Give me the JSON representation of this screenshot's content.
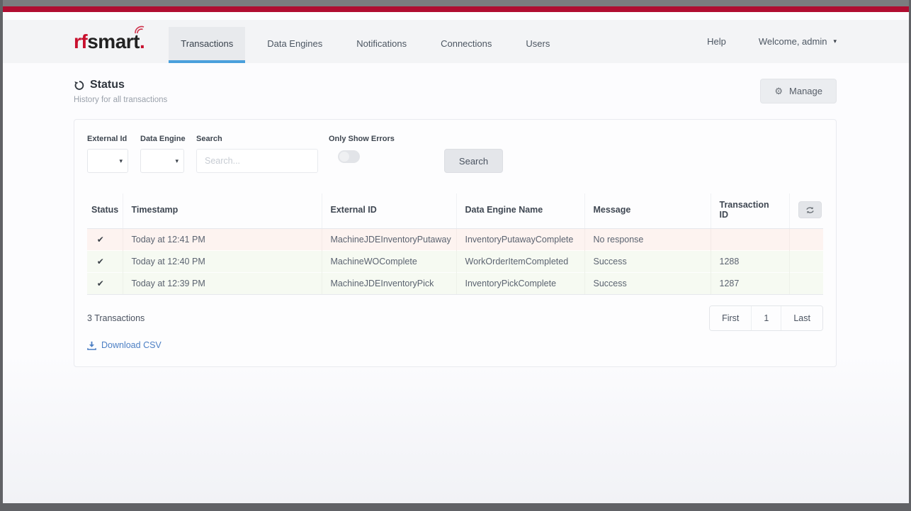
{
  "brand": {
    "logo_rf": "rf",
    "logo_smart": "smart",
    "logo_dot": "."
  },
  "nav": {
    "tabs": [
      {
        "label": "Transactions",
        "active": true
      },
      {
        "label": "Data Engines",
        "active": false
      },
      {
        "label": "Notifications",
        "active": false
      },
      {
        "label": "Connections",
        "active": false
      },
      {
        "label": "Users",
        "active": false
      }
    ],
    "help": "Help",
    "user_menu": "Welcome, admin"
  },
  "header": {
    "title": "Status",
    "subtitle": "History for all transactions",
    "manage_label": "Manage"
  },
  "filters": {
    "external_id_label": "External Id",
    "data_engine_label": "Data Engine",
    "search_label": "Search",
    "only_show_errors_label": "Only Show Errors",
    "search_placeholder": "Search...",
    "search_button": "Search"
  },
  "table": {
    "columns": {
      "status": "Status",
      "timestamp": "Timestamp",
      "external_id": "External ID",
      "data_engine": "Data Engine Name",
      "message": "Message",
      "transaction_id": "Transaction ID"
    },
    "rows": [
      {
        "status": "✔",
        "timestamp": "Today at 12:41 PM",
        "external_id": "MachineJDEInventoryPutaway",
        "data_engine": "InventoryPutawayComplete",
        "message": "No response",
        "transaction_id": ""
      },
      {
        "status": "✔",
        "timestamp": "Today at 12:40 PM",
        "external_id": "MachineWOComplete",
        "data_engine": "WorkOrderItemCompleted",
        "message": "Success",
        "transaction_id": "1288"
      },
      {
        "status": "✔",
        "timestamp": "Today at 12:39 PM",
        "external_id": "MachineJDEInventoryPick",
        "data_engine": "InventoryPickComplete",
        "message": "Success",
        "transaction_id": "1287"
      }
    ]
  },
  "footer": {
    "count": "3 Transactions",
    "pagination": {
      "first": "First",
      "page": "1",
      "last": "Last"
    },
    "download_label": "Download CSV"
  },
  "icons": {
    "gear": "⚙",
    "dropdown_caret": "▾",
    "user_caret": "▾"
  },
  "colors": {
    "brand_red": "#c8102e",
    "chrome_bar_red": "#b00d31",
    "active_tab_underline": "#4aa0dc",
    "row_error_tint": "#fdf3f0",
    "row_success_tint": "#f6faf2",
    "link_blue": "#4c7fc4"
  }
}
